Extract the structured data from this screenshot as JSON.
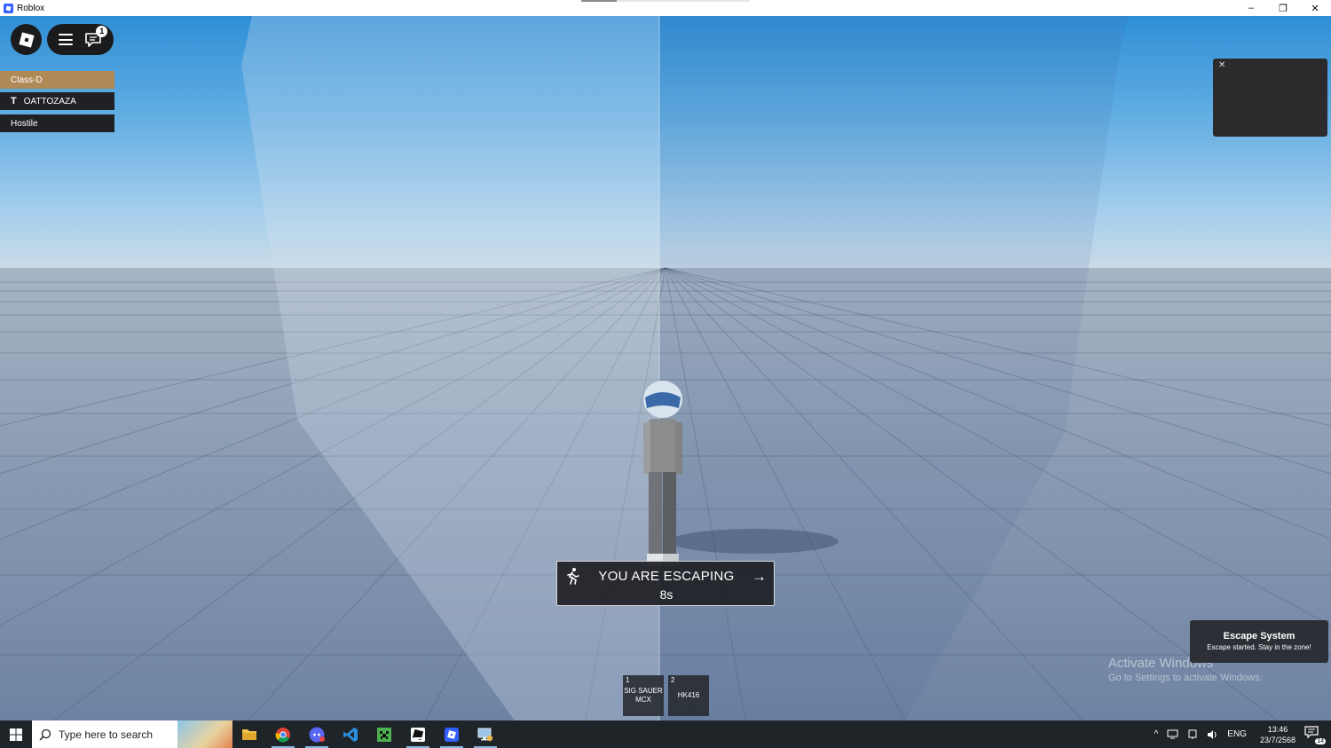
{
  "window": {
    "title": "Roblox",
    "minimize_glyph": "–",
    "restore_glyph": "❐",
    "close_glyph": "✕"
  },
  "top_menu": {
    "chat_badge_count": "1"
  },
  "team_panel": {
    "close_glyph": "✕",
    "team_name": "Class-D",
    "team_color": "#b08a56",
    "player_name": "OATTOZAZA",
    "status": "Hostile"
  },
  "escape_banner": {
    "title": "YOU ARE ESCAPING",
    "countdown": "8s",
    "arrow_glyph": "→"
  },
  "hotbar": {
    "slots": [
      {
        "number": "1",
        "label": "SIG SAUER MCX"
      },
      {
        "number": "2",
        "label": "HK416"
      }
    ]
  },
  "notification": {
    "title": "Escape System",
    "body": "Escape started. Stay in the zone!"
  },
  "watermark": {
    "title": "Activate Windows",
    "subtitle": "Go to Settings to activate Windows."
  },
  "taskbar": {
    "search_placeholder": "Type here to search",
    "apps": [
      "file-explorer-icon",
      "chrome-icon",
      "discord-icon",
      "vscode-icon",
      "minecraft-icon",
      "roblox-studio-icon",
      "roblox-icon",
      "remote-desktop-icon"
    ],
    "tray": {
      "language": "ENG",
      "time": "13:46",
      "date": "23/7/2568",
      "notification_count": "14"
    }
  }
}
